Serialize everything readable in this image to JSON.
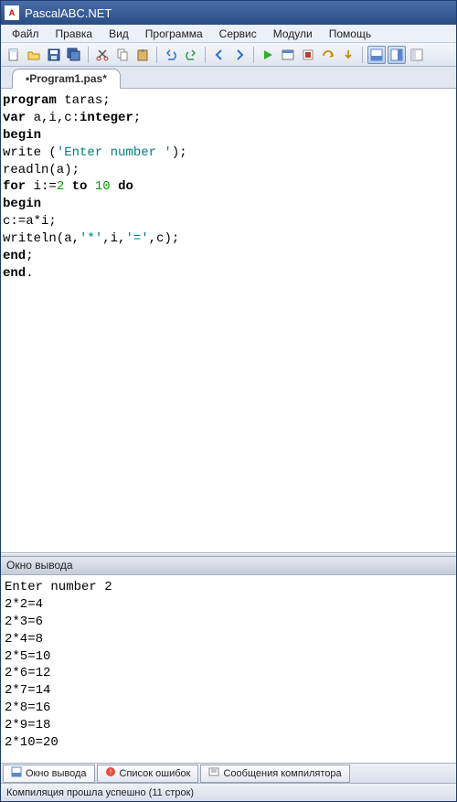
{
  "window": {
    "title": "PascalABC.NET"
  },
  "menu": {
    "file": "Файл",
    "edit": "Правка",
    "view": "Вид",
    "program": "Программа",
    "service": "Сервис",
    "modules": "Модули",
    "help": "Помощь"
  },
  "toolbar_icons": {
    "new": "new-file-icon",
    "open": "open-folder-icon",
    "save": "save-icon",
    "saveall": "save-all-icon",
    "cut": "cut-icon",
    "copy": "copy-icon",
    "paste": "paste-icon",
    "undo": "undo-icon",
    "redo": "redo-icon",
    "nav1": "nav-back-icon",
    "nav2": "nav-fwd-icon",
    "run": "run-icon",
    "compile": "compile-icon",
    "stop": "stop-icon",
    "stepover": "stepover-icon",
    "stepin": "stepin-icon",
    "panel1": "output-panel-icon",
    "panel2": "errors-panel-icon",
    "panel3": "watch-panel-icon"
  },
  "tab": {
    "label": "•Program1.pas*"
  },
  "code": {
    "l1a": "program",
    "l1b": " taras;",
    "l2a": "var",
    "l2b": " a,i,c:",
    "l2c": "integer",
    "l2d": ";",
    "l3": "begin",
    "l4a": "write (",
    "l4b": "'Enter number '",
    "l4c": ");",
    "l5": "readln(a);",
    "l6a": "for",
    "l6b": " i:=",
    "l6c": "2",
    "l6d": " ",
    "l6e": "to",
    "l6f": " ",
    "l6g": "10",
    "l6h": " ",
    "l6i": "do",
    "l7": "begin",
    "l8": "c:=a*i;",
    "l9a": "writeln(a,",
    "l9b": "'*'",
    "l9c": ",i,",
    "l9d": "'='",
    "l9e": ",c);",
    "l10a": "end",
    "l10b": ";",
    "l11a": "end",
    "l11b": "."
  },
  "output_panel": {
    "title": "Окно вывода"
  },
  "output_lines": [
    "Enter number 2",
    "2*2=4",
    "2*3=6",
    "2*4=8",
    "2*5=10",
    "2*6=12",
    "2*7=14",
    "2*8=16",
    "2*9=18",
    "2*10=20"
  ],
  "bottom_tabs": {
    "output": "Окно вывода",
    "errors": "Список ошибок",
    "messages": "Сообщения компилятора"
  },
  "status": {
    "text": "Компиляция прошла успешно (11 строк)"
  }
}
